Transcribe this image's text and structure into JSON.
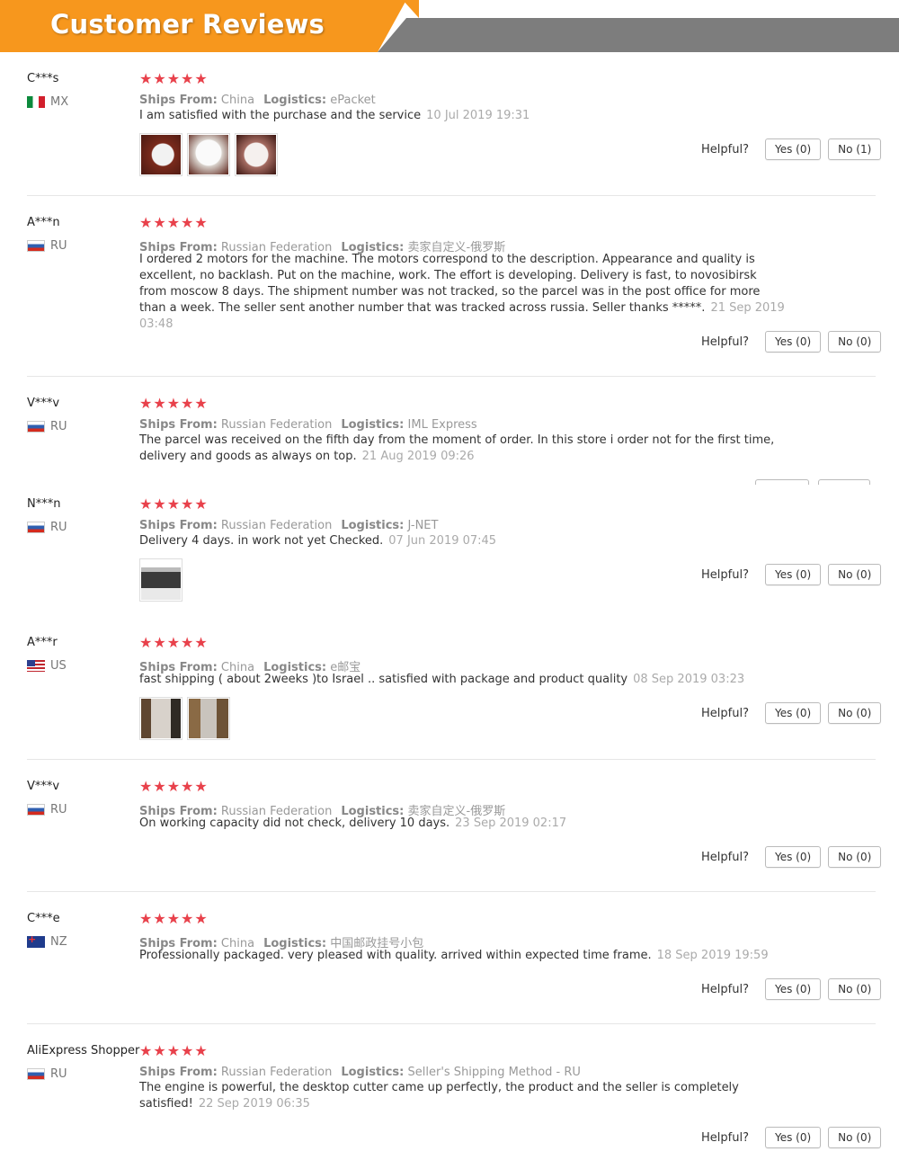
{
  "header": {
    "title": "Customer Reviews"
  },
  "labels": {
    "ships_from": "Ships From:",
    "logistics": "Logistics:",
    "helpful": "Helpful?",
    "stars": "★★★★★"
  },
  "reviews": [
    {
      "user": "C***s",
      "country": "MX",
      "ships": "China",
      "logistics": "ePacket",
      "text": "I am satisfied with the purchase and the service",
      "date": "10 Jul 2019 19:31",
      "yes": "Yes (0)",
      "no": "No (1)"
    },
    {
      "user": "A***n",
      "country": "RU",
      "ships": "Russian Federation",
      "logistics": "卖家自定义-俄罗斯",
      "text": "I ordered 2 motors for the machine. The motors correspond to the description. Appearance and quality is excellent, no backlash. Put on the machine, work. The effort is developing. Delivery is fast, to novosibirsk from moscow 8 days. The shipment number was not tracked, so the parcel was in the post office for more than a week. The seller sent another number that was tracked across russia. Seller thanks *****.",
      "date": "21 Sep 2019 03:48",
      "yes": "Yes (0)",
      "no": "No (0)"
    },
    {
      "user": "V***v",
      "country": "RU",
      "ships": "Russian Federation",
      "logistics": "IML Express",
      "text": "The parcel was received on the fifth day from the moment of order. In this store i order not for the first time, delivery and goods as always on top.",
      "date": "21 Aug 2019 09:26"
    },
    {
      "user": "N***n",
      "country": "RU",
      "ships": "Russian Federation",
      "logistics": "J-NET",
      "text": "Delivery 4 days. in work not yet Checked.",
      "date": "07 Jun 2019 07:45",
      "yes": "Yes (0)",
      "no": "No (0)"
    },
    {
      "user": "A***r",
      "country": "US",
      "ships": "China",
      "logistics": "e邮宝",
      "text": "fast shipping ( about 2weeks )to Israel .. satisfied with package and product quality",
      "date": "08 Sep 2019 03:23",
      "yes": "Yes (0)",
      "no": "No (0)"
    },
    {
      "user": "V***v",
      "country": "RU",
      "ships": "Russian Federation",
      "logistics": "卖家自定义-俄罗斯",
      "text": "On working capacity did not check, delivery 10 days.",
      "date": "23 Sep 2019 02:17",
      "yes": "Yes (0)",
      "no": "No (0)"
    },
    {
      "user": "C***e",
      "country": "NZ",
      "ships": "China",
      "logistics": "中国邮政挂号小包",
      "text": "Professionally packaged. very pleased with quality. arrived within expected time frame.",
      "date": "18 Sep 2019 19:59",
      "yes": "Yes (0)",
      "no": "No (0)"
    },
    {
      "user": "AliExpress Shopper",
      "country": "RU",
      "ships": "Russian Federation",
      "logistics": "Seller's Shipping Method - RU",
      "text": "The engine is powerful, the desktop cutter came up perfectly, the product and the seller is completely satisfied!",
      "date": "22 Sep 2019 06:35",
      "yes": "Yes (0)",
      "no": "No (0)"
    }
  ]
}
